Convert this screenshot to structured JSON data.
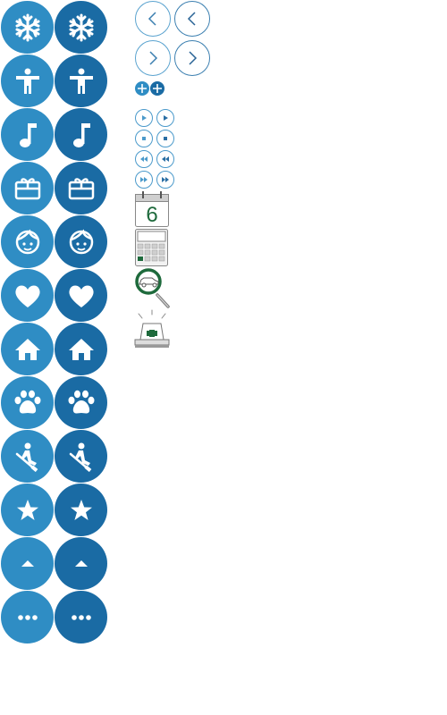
{
  "colors": {
    "light_blue": "#2f8dc4",
    "dark_blue": "#1a6ba4",
    "outline_blue": "#4b9acb",
    "green": "#1e6a3c"
  },
  "icon_rows": [
    {
      "icon": "snowflake-icon"
    },
    {
      "icon": "accessibility-icon"
    },
    {
      "icon": "music-note-icon"
    },
    {
      "icon": "gift-card-icon"
    },
    {
      "icon": "child-face-icon"
    },
    {
      "icon": "heart-icon"
    },
    {
      "icon": "home-icon"
    },
    {
      "icon": "paw-icon"
    },
    {
      "icon": "rowing-icon"
    },
    {
      "icon": "star-icon"
    },
    {
      "icon": "caret-up-icon"
    },
    {
      "icon": "more-icon"
    }
  ],
  "nav_buttons": [
    "back-arrow",
    "back-arrow",
    "forward-arrow",
    "forward-arrow"
  ],
  "media_buttons": [
    "play",
    "play",
    "stop",
    "stop",
    "rewind",
    "rewind",
    "fast-forward",
    "fast-forward"
  ],
  "calendar": {
    "day": "6"
  }
}
